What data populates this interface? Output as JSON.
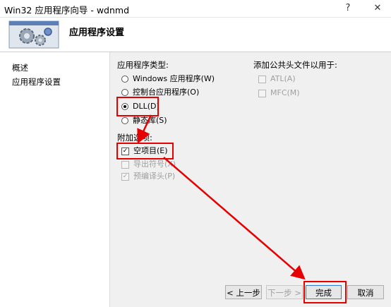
{
  "window": {
    "title": "Win32 应用程序向导 - wdnmd",
    "help_icon": "?",
    "close_icon": "✕"
  },
  "header": {
    "title": "应用程序设置"
  },
  "sidebar": {
    "items": [
      {
        "label": "概述"
      },
      {
        "label": "应用程序设置"
      }
    ]
  },
  "app_type": {
    "label": "应用程序类型:",
    "options": [
      {
        "label": "Windows 应用程序(W)",
        "checked": false
      },
      {
        "label": "控制台应用程序(O)",
        "checked": false
      },
      {
        "label": "DLL(D)",
        "checked": true
      },
      {
        "label": "静态库(S)",
        "checked": false
      }
    ]
  },
  "extra_options": {
    "label": "附加选项:",
    "options": [
      {
        "label": "空项目(E)",
        "checked": true,
        "enabled": true
      },
      {
        "label": "导出符号(X)",
        "checked": false,
        "enabled": false
      },
      {
        "label": "预编译头(P)",
        "checked": true,
        "enabled": false
      }
    ]
  },
  "common_headers": {
    "label": "添加公共头文件以用于:",
    "options": [
      {
        "label": "ATL(A)",
        "checked": false,
        "enabled": false
      },
      {
        "label": "MFC(M)",
        "checked": false,
        "enabled": false
      }
    ]
  },
  "buttons": {
    "prev": "< 上一步",
    "next": "下一步 >",
    "finish": "完成",
    "cancel": "取消"
  },
  "colors": {
    "highlight": "#e60000",
    "content_bg": "#f0f0f0"
  }
}
